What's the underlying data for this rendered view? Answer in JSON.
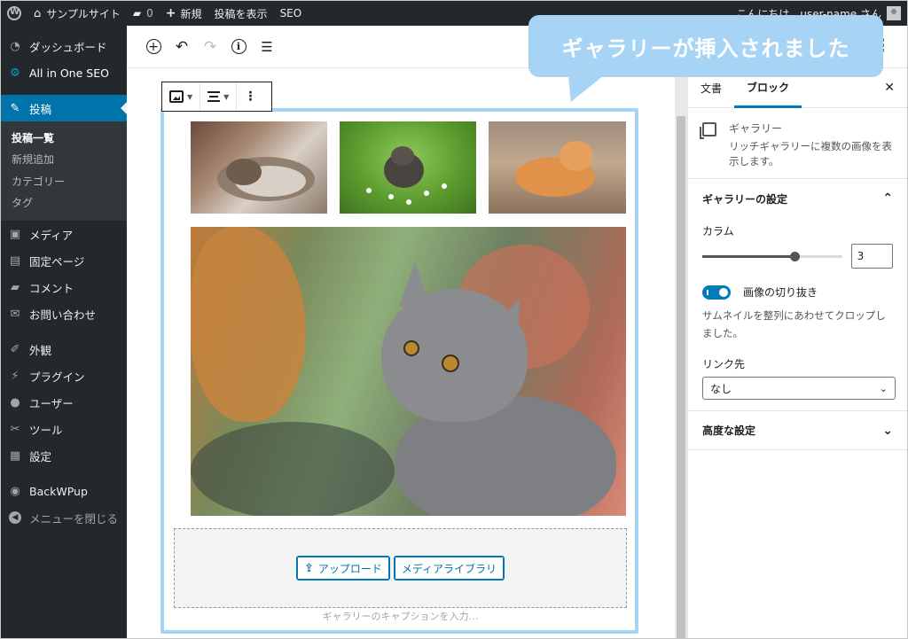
{
  "adminbar": {
    "site_name": "サンプルサイト",
    "comments_count": "0",
    "new_label": "新規",
    "view_post_label": "投稿を表示",
    "seo_label": "SEO",
    "greeting": "こんにちは、user-name さん"
  },
  "sidebar": {
    "items": [
      {
        "label": "ダッシュボード",
        "icon": "dashboard-icon",
        "glyph": "◔"
      },
      {
        "label": "All in One SEO",
        "icon": "gear-icon",
        "glyph": "⚙"
      },
      {
        "label": "投稿",
        "icon": "pin-icon",
        "glyph": "✎"
      }
    ],
    "submenu": [
      "投稿一覧",
      "新規追加",
      "カテゴリー",
      "タグ"
    ],
    "items2": [
      {
        "label": "メディア",
        "icon": "media-icon",
        "glyph": "▣"
      },
      {
        "label": "固定ページ",
        "icon": "page-icon",
        "glyph": "▤"
      },
      {
        "label": "コメント",
        "icon": "comment-icon",
        "glyph": "▰"
      },
      {
        "label": "お問い合わせ",
        "icon": "mail-icon",
        "glyph": "✉"
      }
    ],
    "items3": [
      {
        "label": "外観",
        "icon": "brush-icon",
        "glyph": "✐"
      },
      {
        "label": "プラグイン",
        "icon": "plugin-icon",
        "glyph": "⚡"
      },
      {
        "label": "ユーザー",
        "icon": "user-icon",
        "glyph": "●"
      },
      {
        "label": "ツール",
        "icon": "wrench-icon",
        "glyph": "✂"
      },
      {
        "label": "設定",
        "icon": "settings-icon",
        "glyph": "▦"
      }
    ],
    "backwpup": "BackWPup",
    "collapse": "メニューを閉じる"
  },
  "callout": "ギャラリーが挿入されました",
  "editor": {
    "upload_button": "アップロード",
    "media_library_button": "メディアライブラリ",
    "caption_placeholder": "ギャラリーのキャプションを入力…"
  },
  "rsidebar": {
    "tab_document": "文書",
    "tab_block": "ブロック",
    "block_title": "ギャラリー",
    "block_desc": "リッチギャラリーに複数の画像を表示します。",
    "gallery_settings": "ギャラリーの設定",
    "columns_label": "カラム",
    "columns_value": "3",
    "columns_fraction": 0.66,
    "crop_label": "画像の切り抜き",
    "crop_help": "サムネイルを整列にあわせてクロップしました。",
    "link_label": "リンク先",
    "link_value": "なし",
    "advanced": "高度な設定"
  }
}
